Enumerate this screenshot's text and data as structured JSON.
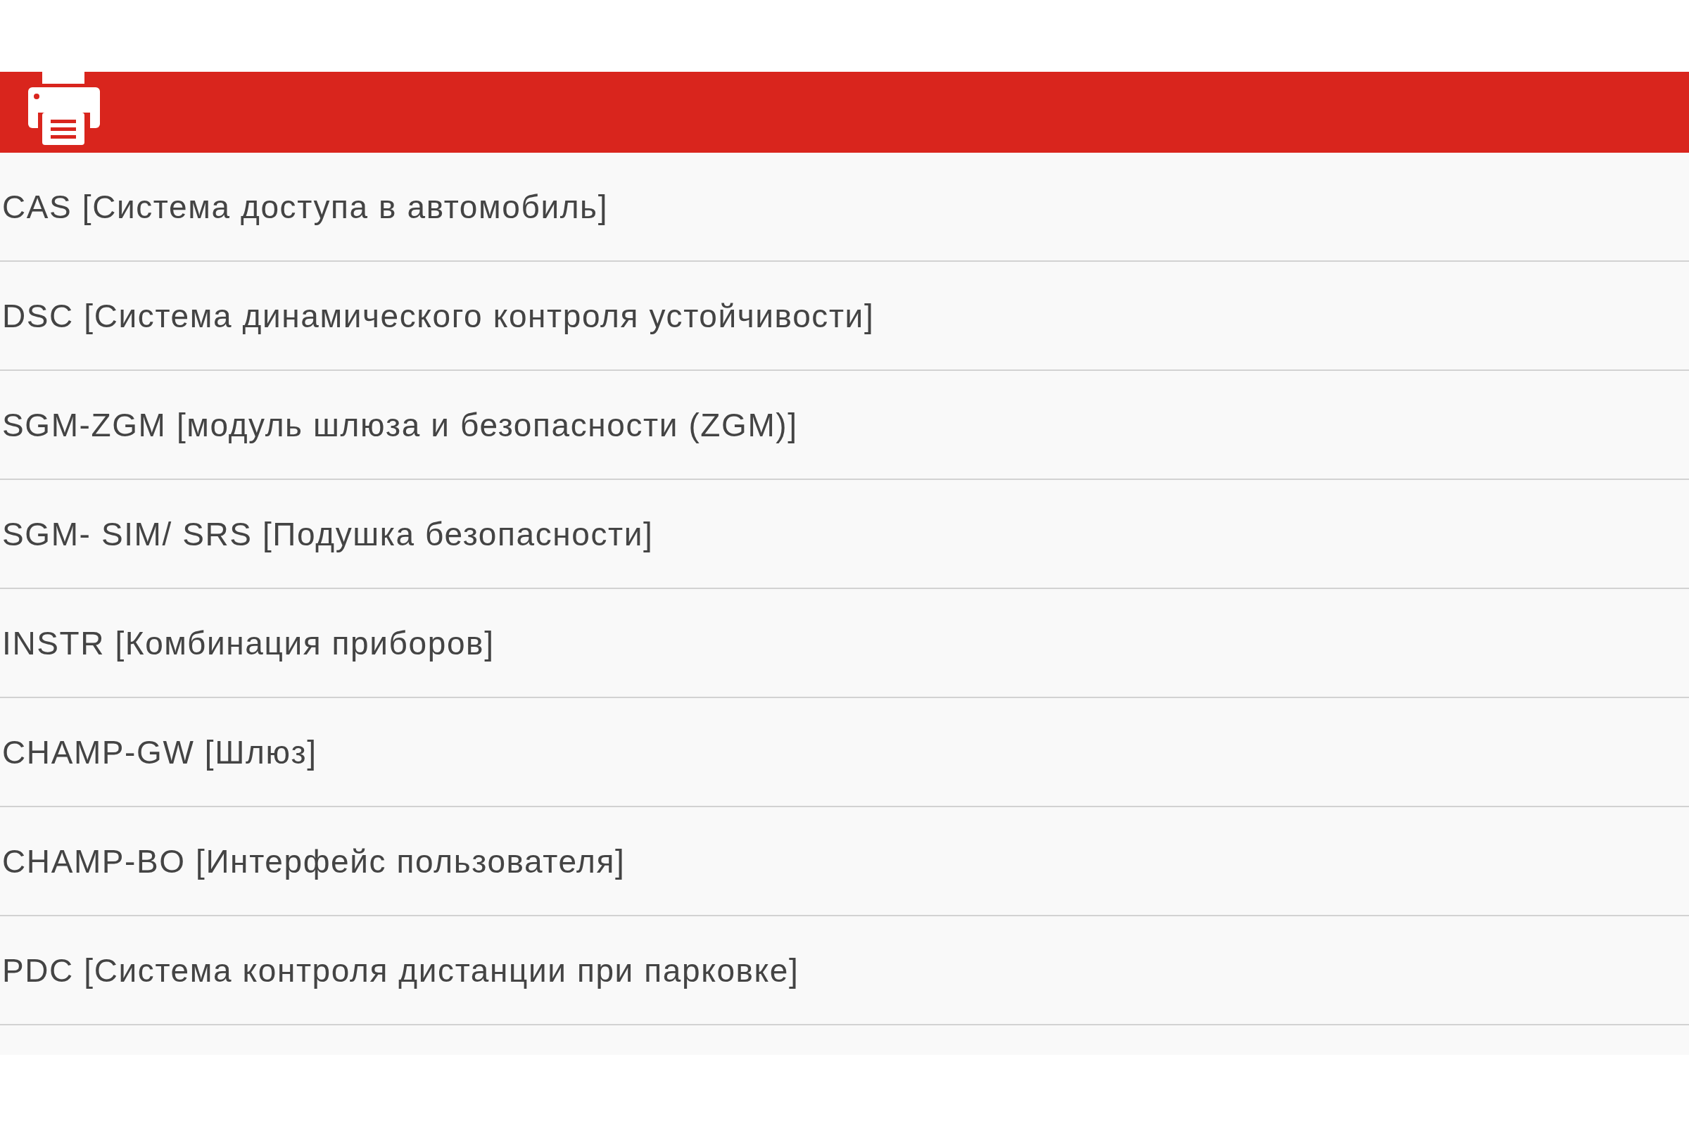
{
  "items": [
    {
      "label": "CAS [Система доступа в автомобиль]"
    },
    {
      "label": "DSC [Система динамического контроля устойчивости]"
    },
    {
      "label": "SGM-ZGM [модуль шлюза и безопасности (ZGM)]"
    },
    {
      "label": "SGM- SIM/ SRS [Подушка безопасности]"
    },
    {
      "label": "INSTR [Комбинация приборов]"
    },
    {
      "label": "CHAMP-GW [Шлюз]"
    },
    {
      "label": "CHAMP-BO [Интерфейс пользователя]"
    },
    {
      "label": "PDC [Система контроля дистанции при парковке]"
    }
  ]
}
